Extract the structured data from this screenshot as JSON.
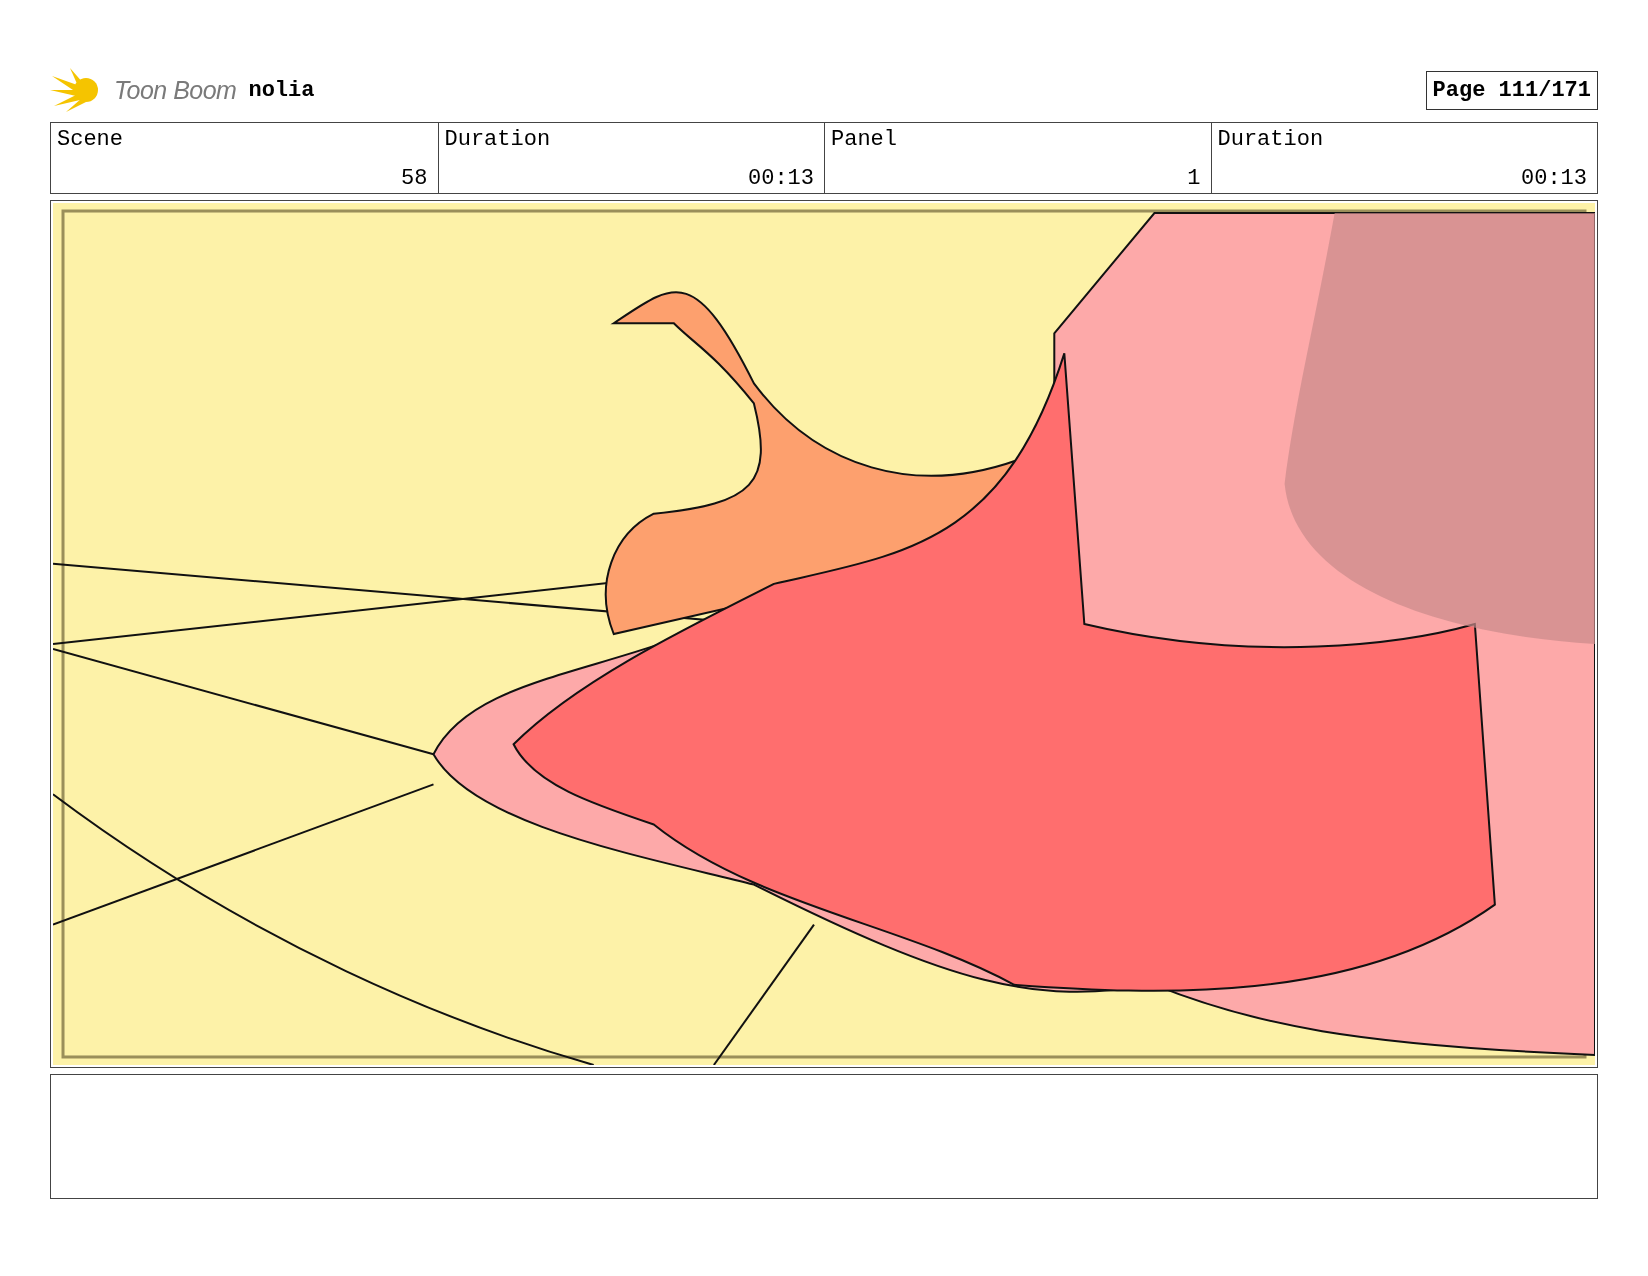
{
  "header": {
    "brand": "Toon Boom",
    "project": "nolia",
    "page": "Page 111/171"
  },
  "info_table": {
    "columns": [
      "Scene",
      "Duration",
      "Panel",
      "Duration"
    ],
    "values": [
      "58",
      "00:13",
      "1",
      "00:13"
    ]
  }
}
